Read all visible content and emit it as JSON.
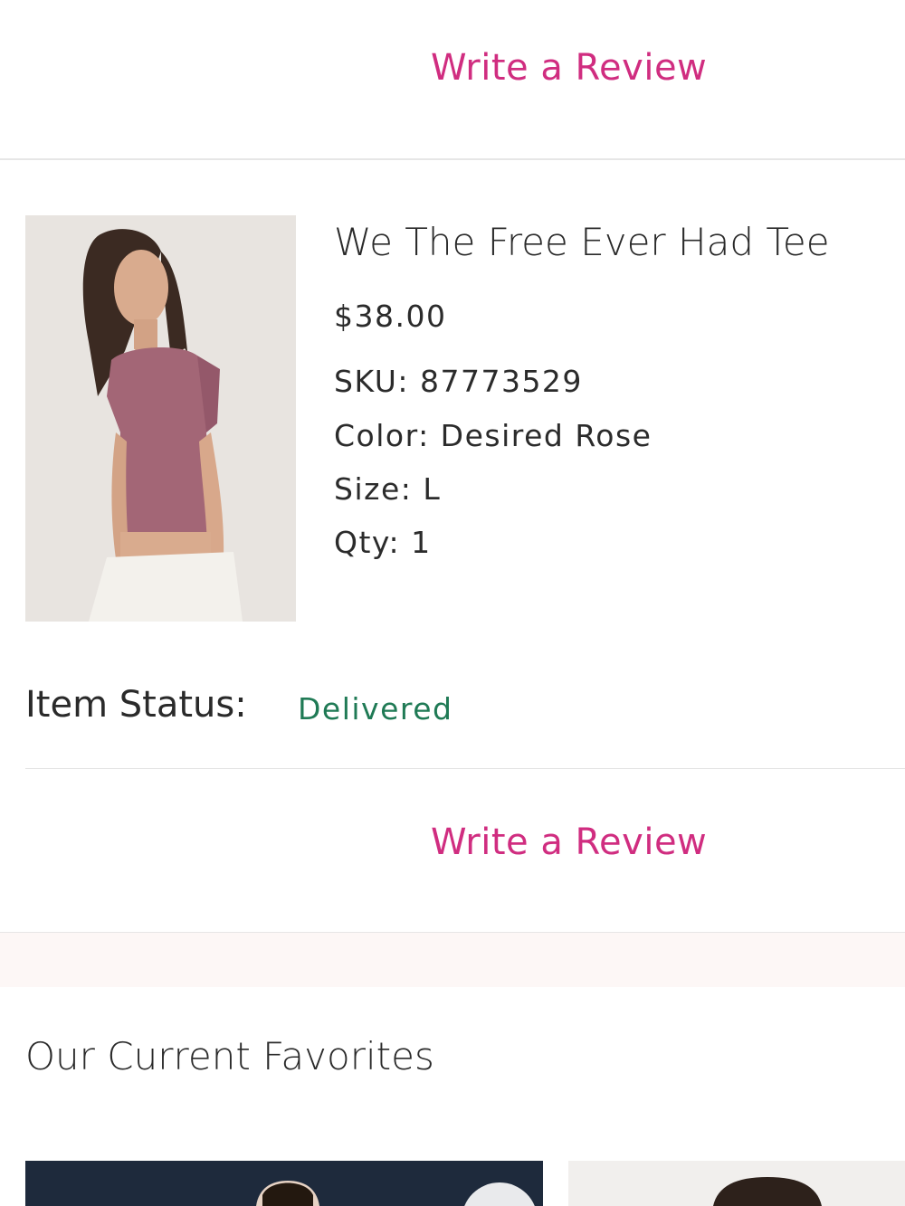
{
  "order_item": {
    "write_review_label": "Write a Review",
    "name": "We The Free Ever Had Tee",
    "price": "$38.00",
    "sku": "SKU: 87773529",
    "color": "Color: Desired Rose",
    "size": "Size: L",
    "qty": "Qty: 1",
    "status_label": "Item Status:",
    "status_value": "Delivered"
  },
  "favorites": {
    "title": "Our Current Favorites"
  },
  "colors": {
    "accent": "#d02d80",
    "status_delivered": "#1f7a55"
  }
}
